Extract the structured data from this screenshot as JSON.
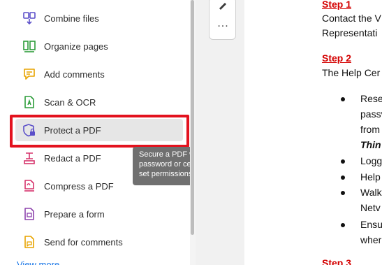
{
  "tools": [
    {
      "label": "Combine files",
      "icon": "combine-files-icon"
    },
    {
      "label": "Organize pages",
      "icon": "organize-pages-icon"
    },
    {
      "label": "Add comments",
      "icon": "add-comments-icon"
    },
    {
      "label": "Scan & OCR",
      "icon": "scan-ocr-icon"
    },
    {
      "label": "Protect a PDF",
      "icon": "protect-pdf-icon",
      "active": true
    },
    {
      "label": "Redact a PDF",
      "icon": "redact-pdf-icon"
    },
    {
      "label": "Compress a PDF",
      "icon": "compress-pdf-icon"
    },
    {
      "label": "Prepare a form",
      "icon": "prepare-form-icon"
    },
    {
      "label": "Send for comments",
      "icon": "send-for-comments-icon"
    }
  ],
  "view_more": "View more",
  "tooltip": {
    "line1": "Secure a PDF with a",
    "line2": "password or certificate and",
    "line3": "set permissions"
  },
  "toolbar": {
    "more_label": "..."
  },
  "document": {
    "step1": "Step 1",
    "line_contact": "Contact the V",
    "line_representative": "Representati",
    "step2": "Step 2",
    "line_help": "The Help Cer",
    "bullet1_line1": "Rese",
    "bullet1_line2": "passv",
    "bullet1_line3": "from",
    "bullet1_line4": "Thin",
    "bullet2": "Logg",
    "bullet3": "Help",
    "bullet4_line1": "Walk",
    "bullet4_line2": "Netv",
    "bullet5_line1": "Ensu",
    "bullet5_line2": "wher",
    "step3": "Step 3"
  },
  "colors": {
    "highlight": "#e3121e",
    "step_text": "#d40000",
    "tooltip_bg": "#707070",
    "link": "#1473e6"
  }
}
